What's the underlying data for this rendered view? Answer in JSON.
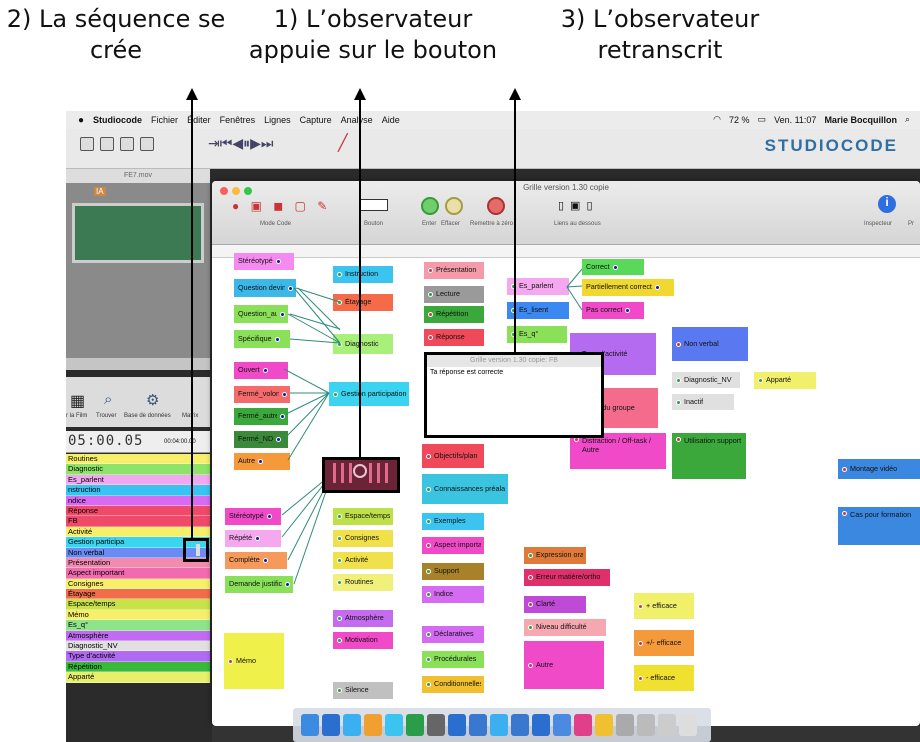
{
  "captions": {
    "c2": "2) La séquence se\ncrée",
    "c1": "1) L’observateur\nappuie sur le bouton",
    "c3": "3) L’observateur\nretranscrit"
  },
  "menubar": {
    "app": "Studiocode",
    "items": [
      "Fichier",
      "Éditer",
      "Fenêtres",
      "Lignes",
      "Capture",
      "Analyse",
      "Aide"
    ],
    "battery": "72 %",
    "clock": "Ven. 11:07",
    "user": "Marie Bocquillon"
  },
  "logo": "STUDIOCODE",
  "movie": {
    "title": "FE7.mov",
    "ia": "IA"
  },
  "tools": [
    "r la Film",
    "Trouver",
    "Base de données",
    "Matrix"
  ],
  "timecode": "05:00.05",
  "timeline": {
    "t1": "00:04:00.00"
  },
  "rows": [
    {
      "label": "Routines",
      "color": "#f6ef6a"
    },
    {
      "label": "Diagnostic",
      "color": "#8fe36b"
    },
    {
      "label": "Es_parlent",
      "color": "#f2a7f2"
    },
    {
      "label": "nstruction",
      "color": "#39c3f2"
    },
    {
      "label": "ndice",
      "color": "#d96bf2"
    },
    {
      "label": "Réponse",
      "color": "#f04a6a"
    },
    {
      "label": "FB",
      "color": "#f04a6a"
    },
    {
      "label": "Activité",
      "color": "#f6ef6a"
    },
    {
      "label": "Gestion participa",
      "color": "#39d6f2"
    },
    {
      "label": "Non verbal",
      "color": "#6b8bf2"
    },
    {
      "label": "Présentation",
      "color": "#f28bb0"
    },
    {
      "label": "Aspect important",
      "color": "#f26bb0"
    },
    {
      "label": "Consignes",
      "color": "#f6ef6a"
    },
    {
      "label": "Étayage",
      "color": "#f26b4a"
    },
    {
      "label": "Espace/temps",
      "color": "#c8e34a"
    },
    {
      "label": "Mémo",
      "color": "#f6ef6a"
    },
    {
      "label": "Es_q°",
      "color": "#8fe38b"
    },
    {
      "label": "Atmosphère",
      "color": "#c06bf2"
    },
    {
      "label": "Diagnostic_NV",
      "color": "#e0e0e0"
    },
    {
      "label": "Type d'activité",
      "color": "#b06bf2"
    },
    {
      "label": "Répétition",
      "color": "#3ab83a"
    },
    {
      "label": "Apparté",
      "color": "#e8f06b"
    }
  ],
  "window": {
    "title": "Grille version 1.30 copie",
    "mode_code": "Mode Code",
    "bouton": "Bouton",
    "enter": "Enter",
    "effacer": "Effacer",
    "remettre": "Remettre à zéro",
    "liens": "Liens au dessous",
    "inspecteur": "Inspecteur",
    "pr": "Pr"
  },
  "popup": {
    "title": "Grille version 1.30 copie: FB",
    "text": "Ta réponse est correcte"
  },
  "buttons": {
    "stereotype1": "Stéréotypé",
    "question_devinette": "Question devinette",
    "question_autre": "Question_autre",
    "specifique": "Spécifique",
    "instruction": "Instruction",
    "etayage": "Étayage",
    "diagnostic": "Diagnostic",
    "presentation": "Présentation",
    "lecture": "Lecture",
    "repetition": "Répétition",
    "reponse": "Réponse",
    "es_parlent": "Es_parlent",
    "es_lisent": "Es_lisent",
    "es_q": "Es_q°",
    "correct": "Correct",
    "partiellement": "Partiellement correct",
    "pas_correct": "Pas correct",
    "type_activite": "Type d'activité",
    "non_verbal": "Non verbal",
    "ouvert": "Ouvert",
    "ferme_volontaire": "Fermé_volontaire",
    "ferme_autre": "Fermé_autre",
    "ferme_nd": "Fermé_ND",
    "autre1": "Autre",
    "gestion": "Gestion participation",
    "taille_groupe": "Taille du groupe",
    "diagnostic_nv": "Diagnostic_NV",
    "inactif": "Inactif",
    "apparte": "Apparté",
    "objectifs": "Objectifs/plan",
    "distraction": "Distraction / Off-task / Autre",
    "utilisation": "Utilisation support",
    "montage": "Montage vidéo",
    "cas_formation": "Cas pour formation",
    "connaissances": "Connaissances préalables",
    "stereotype2": "Stéréotypé",
    "repete": "Répété",
    "complete": "Complète",
    "demande": "Demande justification",
    "espace": "Espace/temps",
    "consignes": "Consignes",
    "activite": "Activité",
    "routines": "Routines",
    "exemples": "Exemples",
    "aspect": "Aspect important",
    "support": "Support",
    "indice": "Indice",
    "expression": "Expression orale",
    "erreur": "Erreur matière/ortho",
    "clarte": "Clarté",
    "niveau": "Niveau difficulté",
    "autre2": "Autre",
    "plus_eff": "+ efficace",
    "pm_eff": "+/- efficace",
    "moins_eff": "- efficace",
    "atmosphere": "Atmosphère",
    "motivation": "Motivation",
    "memo": "Mémo",
    "declaratives": "Déclaratives",
    "procedurales": "Procédurales",
    "conditionnelles": "Conditionnelles",
    "silence": "Silence"
  }
}
